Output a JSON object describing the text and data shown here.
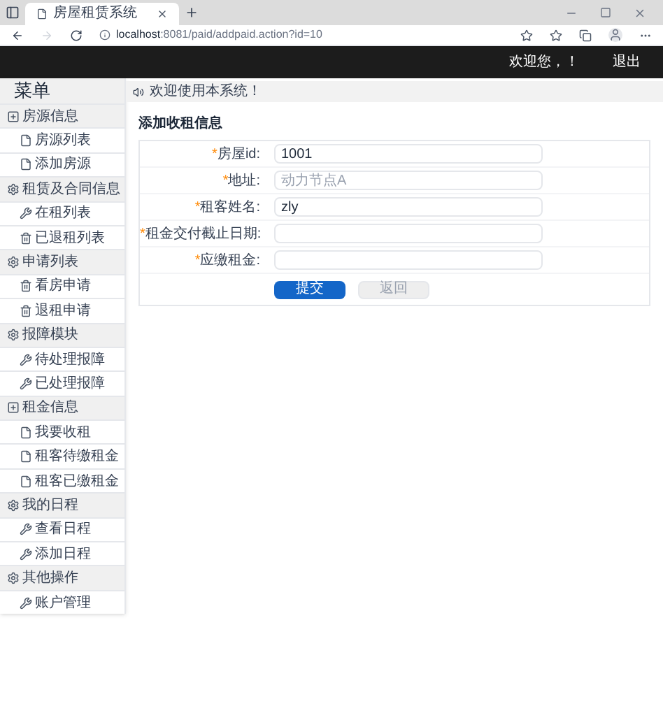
{
  "browser": {
    "tab_title": "房屋租赁系统",
    "url_host": "localhost",
    "url_rest": ":8081/paid/addpaid.action?id=10"
  },
  "header": {
    "welcome": "欢迎您，！",
    "logout": "退出"
  },
  "sidebar": {
    "title": "菜单",
    "groups": [
      {
        "label": "房源信息",
        "kind": "plus",
        "items": [
          {
            "label": "房源列表",
            "kind": "file"
          },
          {
            "label": "添加房源",
            "kind": "file"
          }
        ]
      },
      {
        "label": "租赁及合同信息",
        "kind": "gear",
        "items": [
          {
            "label": "在租列表",
            "kind": "wrench"
          },
          {
            "label": "已退租列表",
            "kind": "trash"
          }
        ]
      },
      {
        "label": "申请列表",
        "kind": "gear",
        "items": [
          {
            "label": "看房申请",
            "kind": "trash"
          },
          {
            "label": "退租申请",
            "kind": "trash"
          }
        ]
      },
      {
        "label": "报障模块",
        "kind": "gear",
        "items": [
          {
            "label": "待处理报障",
            "kind": "wrench"
          },
          {
            "label": "已处理报障",
            "kind": "wrench"
          }
        ]
      },
      {
        "label": "租金信息",
        "kind": "plus",
        "items": [
          {
            "label": "我要收租",
            "kind": "file"
          },
          {
            "label": "租客待缴租金",
            "kind": "file"
          },
          {
            "label": "租客已缴租金",
            "kind": "file"
          }
        ]
      },
      {
        "label": "我的日程",
        "kind": "gear",
        "items": [
          {
            "label": "查看日程",
            "kind": "wrench"
          },
          {
            "label": "添加日程",
            "kind": "wrench"
          }
        ]
      },
      {
        "label": "其他操作",
        "kind": "gear",
        "items": [
          {
            "label": "账户管理",
            "kind": "wrench"
          }
        ]
      }
    ]
  },
  "notice": "欢迎使用本系统！",
  "form": {
    "title": "添加收租信息",
    "fields": [
      {
        "mark": "*",
        "label": "房屋id:",
        "value": "1001"
      },
      {
        "mark": "*",
        "label": "地址:",
        "placeholder": "动力节点A"
      },
      {
        "mark": "*",
        "label": "租客姓名:",
        "value": "zly"
      },
      {
        "mark": "*",
        "label": "租金交付截止日期:"
      },
      {
        "mark": "*",
        "label": "应缴租金:"
      }
    ],
    "submit": "提交",
    "back": "返回"
  }
}
